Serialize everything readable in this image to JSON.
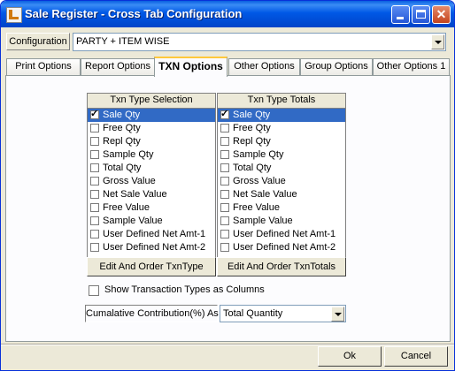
{
  "window": {
    "title": "Sale Register - Cross Tab Configuration"
  },
  "configuration": {
    "label": "Configuration",
    "value": "PARTY + ITEM WISE"
  },
  "tabs": [
    {
      "label": "Print Options"
    },
    {
      "label": "Report Options"
    },
    {
      "label": "TXN Options",
      "active": true
    },
    {
      "label": "Other Options"
    },
    {
      "label": "Group Options"
    },
    {
      "label": "Other Options 1"
    }
  ],
  "txn_selection": {
    "header": "Txn Type Selection",
    "items": [
      {
        "label": "Sale Qty",
        "checked": true,
        "selected": true
      },
      {
        "label": "Free Qty",
        "checked": false
      },
      {
        "label": "Repl Qty",
        "checked": false
      },
      {
        "label": "Sample Qty",
        "checked": false
      },
      {
        "label": "Total Qty",
        "checked": false
      },
      {
        "label": "Gross Value",
        "checked": false
      },
      {
        "label": "Net Sale Value",
        "checked": false
      },
      {
        "label": "Free Value",
        "checked": false
      },
      {
        "label": "Sample Value",
        "checked": false
      },
      {
        "label": "User Defined Net Amt-1",
        "checked": false
      },
      {
        "label": "User Defined Net Amt-2",
        "checked": false
      }
    ],
    "button": "Edit And Order TxnType"
  },
  "txn_totals": {
    "header": "Txn Type Totals",
    "items": [
      {
        "label": "Sale Qty",
        "checked": true,
        "selected": true
      },
      {
        "label": "Free Qty",
        "checked": false
      },
      {
        "label": "Repl Qty",
        "checked": false
      },
      {
        "label": "Sample Qty",
        "checked": false
      },
      {
        "label": "Total Qty",
        "checked": false
      },
      {
        "label": "Gross Value",
        "checked": false
      },
      {
        "label": "Net Sale Value",
        "checked": false
      },
      {
        "label": "Free Value",
        "checked": false
      },
      {
        "label": "Sample Value",
        "checked": false
      },
      {
        "label": "User Defined Net Amt-1",
        "checked": false
      },
      {
        "label": "User Defined Net Amt-2",
        "checked": false
      }
    ],
    "button": "Edit And Order TxnTotals"
  },
  "show_columns": {
    "label": "Show Transaction Types as Columns",
    "checked": false
  },
  "cumulative": {
    "label": "Cumalative Contribution(%) As",
    "value": "Total Quantity"
  },
  "buttons": {
    "ok": "Ok",
    "cancel": "Cancel"
  },
  "colors": {
    "title_bar": "#0058e6",
    "selection": "#316ac5",
    "active_tab_accent": "#ffc83c",
    "dialog_bg": "#ece9d8"
  }
}
